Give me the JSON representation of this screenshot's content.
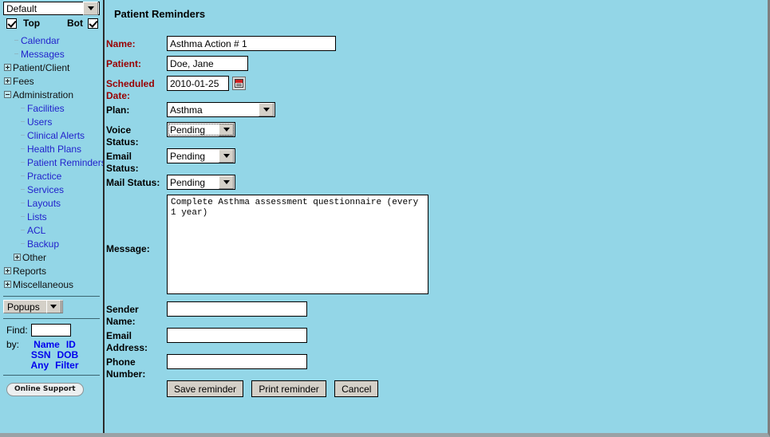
{
  "sidebar": {
    "layout_select": {
      "value": "Default",
      "icon": "chevron-down-icon"
    },
    "checkboxes": {
      "top_label": "Top",
      "bot_label": "Bot",
      "top_checked": true,
      "bot_checked": true
    },
    "tree": [
      {
        "label": "Calendar",
        "level": 1,
        "toggle": "none",
        "link": true
      },
      {
        "label": "Messages",
        "level": 1,
        "toggle": "none",
        "link": true
      },
      {
        "label": "Patient/Client",
        "level": 0,
        "toggle": "plus",
        "link": false
      },
      {
        "label": "Fees",
        "level": 0,
        "toggle": "plus",
        "link": false
      },
      {
        "label": "Administration",
        "level": 0,
        "toggle": "minus",
        "link": false
      },
      {
        "label": "Facilities",
        "level": 2,
        "toggle": "none",
        "link": true
      },
      {
        "label": "Users",
        "level": 2,
        "toggle": "none",
        "link": true
      },
      {
        "label": "Clinical Alerts",
        "level": 2,
        "toggle": "none",
        "link": true
      },
      {
        "label": "Health Plans",
        "level": 2,
        "toggle": "none",
        "link": true
      },
      {
        "label": "Patient Reminders",
        "level": 2,
        "toggle": "none",
        "link": true
      },
      {
        "label": "Practice",
        "level": 2,
        "toggle": "none",
        "link": true
      },
      {
        "label": "Services",
        "level": 2,
        "toggle": "none",
        "link": true
      },
      {
        "label": "Layouts",
        "level": 2,
        "toggle": "none",
        "link": true
      },
      {
        "label": "Lists",
        "level": 2,
        "toggle": "none",
        "link": true
      },
      {
        "label": "ACL",
        "level": 2,
        "toggle": "none",
        "link": true
      },
      {
        "label": "Backup",
        "level": 2,
        "toggle": "none",
        "link": true
      },
      {
        "label": "Other",
        "level": 1,
        "toggle": "plus",
        "link": false
      },
      {
        "label": "Reports",
        "level": 0,
        "toggle": "plus",
        "link": false
      },
      {
        "label": "Miscellaneous",
        "level": 0,
        "toggle": "plus",
        "link": false
      }
    ],
    "popups_select": {
      "value": "Popups",
      "icon": "chevron-down-icon"
    },
    "find": {
      "label": "Find:",
      "value": "",
      "placeholder": ""
    },
    "by": {
      "label": "by:",
      "links": [
        [
          "Name",
          "ID"
        ],
        [
          "SSN",
          "DOB"
        ],
        [
          "Any",
          "Filter"
        ]
      ]
    },
    "support_button": "Online Support"
  },
  "main": {
    "title": "Patient Reminders",
    "form": {
      "name": {
        "label": "Name:",
        "value": "Asthma Action # 1",
        "required": true
      },
      "patient": {
        "label": "Patient:",
        "value": "Doe, Jane",
        "required": true
      },
      "scheduled": {
        "label": "Scheduled Date:",
        "value": "2010-01-25",
        "required": true,
        "icon": "calendar-icon"
      },
      "plan": {
        "label": "Plan:",
        "value": "Asthma",
        "required": false,
        "icon": "chevron-down-icon"
      },
      "voice": {
        "label": "Voice Status:",
        "value": "Pending",
        "required": false,
        "icon": "chevron-down-icon",
        "focused": true
      },
      "email_status": {
        "label": "Email Status:",
        "value": "Pending",
        "required": false,
        "icon": "chevron-down-icon"
      },
      "mail_status": {
        "label": "Mail Status:",
        "value": "Pending",
        "required": false,
        "icon": "chevron-down-icon"
      },
      "message": {
        "label": "Message:",
        "value": "Complete Asthma assessment questionnaire (every 1 year)"
      },
      "sender_name": {
        "label": "Sender Name:",
        "value": ""
      },
      "email_addr": {
        "label": "Email Address:",
        "value": ""
      },
      "phone": {
        "label": "Phone Number:",
        "value": ""
      }
    },
    "buttons": {
      "save": "Save reminder",
      "print": "Print reminder",
      "cancel": "Cancel"
    }
  },
  "colors": {
    "background": "#93d6e7",
    "required_label": "#990000",
    "link": "#2222cc",
    "filter_link": "#0000ee"
  }
}
